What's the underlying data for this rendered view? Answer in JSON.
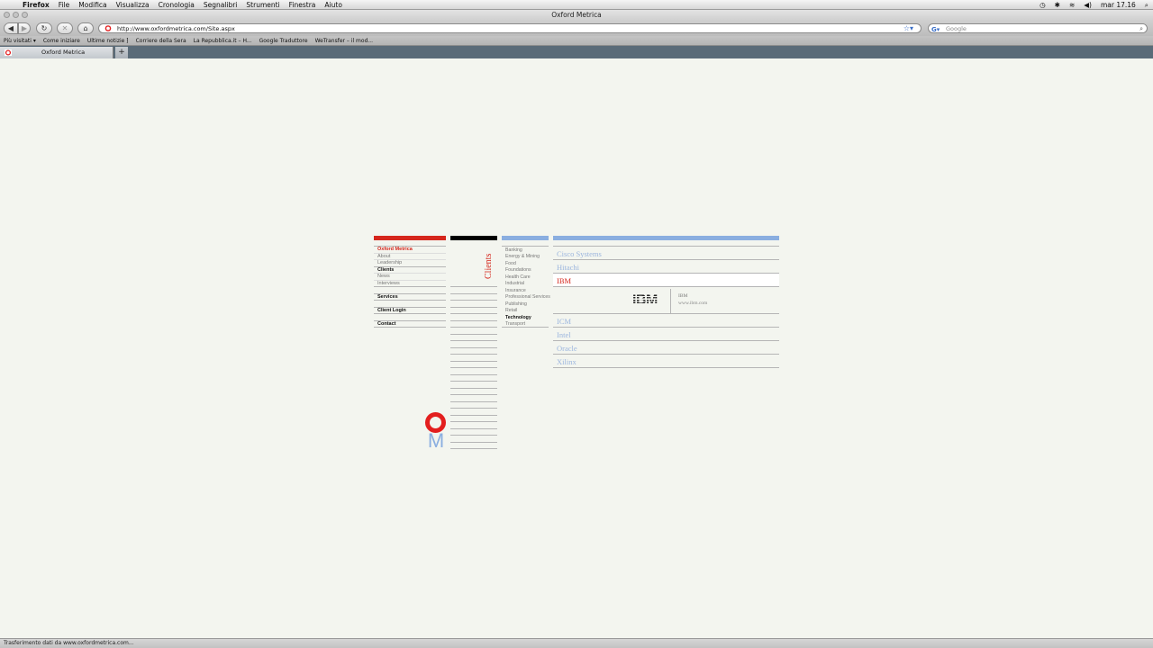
{
  "os_menubar": {
    "items": [
      "Firefox",
      "File",
      "Modifica",
      "Visualizza",
      "Cronologia",
      "Segnalibri",
      "Strumenti",
      "Finestra",
      "Aiuto"
    ],
    "clock": "mar 17.16"
  },
  "window": {
    "title": "Oxford Metrica"
  },
  "toolbar": {
    "back": "◀",
    "forward": "▶",
    "reload": "↻",
    "stop": "✕",
    "home": "⌂",
    "url": "http://www.oxfordmetrica.com/Site.aspx",
    "search_placeholder": "Google"
  },
  "bookmarks": [
    "Più visitati ▾",
    "Come iniziare",
    "Ultime notizie ⁆",
    "Corriere della Sera",
    "La Repubblica.it – H...",
    "Google Traduttore",
    "WeTransfer – il mod..."
  ],
  "tab": {
    "label": "Oxford Metrica",
    "new_tab": "+"
  },
  "status": "Trasferimento dati da www.oxfordmetrica.com...",
  "colors": {
    "red": "#d5261c",
    "blue": "#8aaee0",
    "black": "#000000",
    "background": "#f3f5ef"
  },
  "site": {
    "nav": [
      {
        "label": "Oxford Metrica",
        "style": "red"
      },
      {
        "label": "About",
        "style": "sub"
      },
      {
        "label": "Leadership",
        "style": "sub"
      },
      {
        "label": "Clients",
        "style": "strong"
      },
      {
        "label": "News",
        "style": "sub"
      },
      {
        "label": "Interviews",
        "style": "sub"
      },
      {
        "label": "Services",
        "style": "strong"
      },
      {
        "label": "Client Login",
        "style": "strong"
      },
      {
        "label": "Contact",
        "style": "strong"
      }
    ],
    "section_title": "Clients",
    "sectors": [
      "Banking",
      "Energy & Mining",
      "Food",
      "Foundations",
      "Health Care",
      "Industrial",
      "Insurance",
      "Professional Services",
      "Publishing",
      "Retail",
      "Technology",
      "Transport"
    ],
    "active_sector": "Technology",
    "clients": [
      "Cisco Systems",
      "Hitachi",
      "IBM",
      "ICM",
      "Intel",
      "Oracle",
      "Xilinx"
    ],
    "active_client": "IBM",
    "detail": {
      "logo": "IBM",
      "name": "IBM",
      "url": "www.ibm.com"
    },
    "logo_letters": {
      "o": "O",
      "m": "M"
    }
  }
}
